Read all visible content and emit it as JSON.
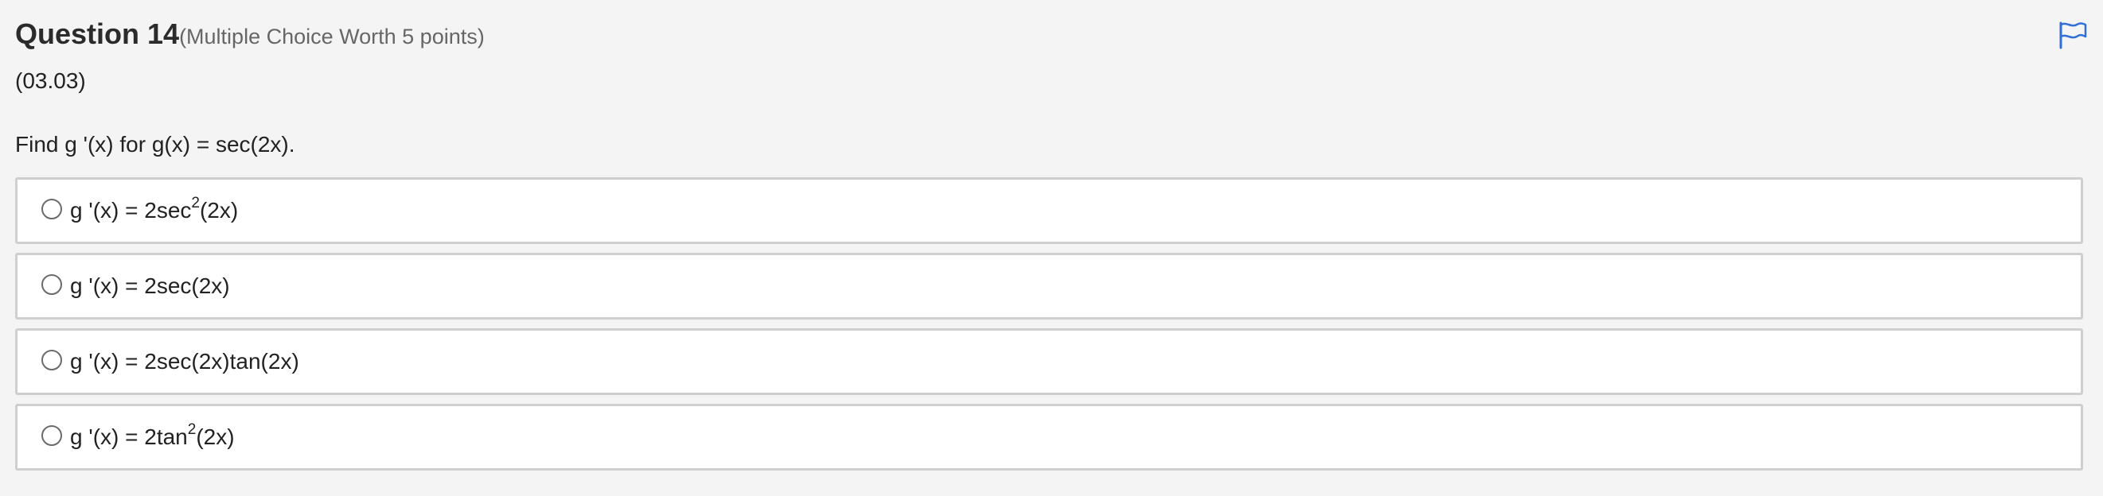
{
  "question": {
    "title": "Question 14",
    "worth": "(Multiple Choice Worth 5 points)",
    "code": "(03.03)",
    "prompt": "Find g '(x) for g(x) = sec(2x)."
  },
  "icons": {
    "flag": "flag-icon",
    "flag_color": "#2f6fd6"
  },
  "choices": [
    {
      "pre": "g '(x) = 2sec",
      "sup": "2",
      "post": "(2x)"
    },
    {
      "pre": "g '(x) = 2sec(2x)",
      "sup": "",
      "post": ""
    },
    {
      "pre": "g '(x) = 2sec(2x)tan(2x)",
      "sup": "",
      "post": ""
    },
    {
      "pre": "g '(x) = 2tan",
      "sup": "2",
      "post": "(2x)"
    }
  ]
}
